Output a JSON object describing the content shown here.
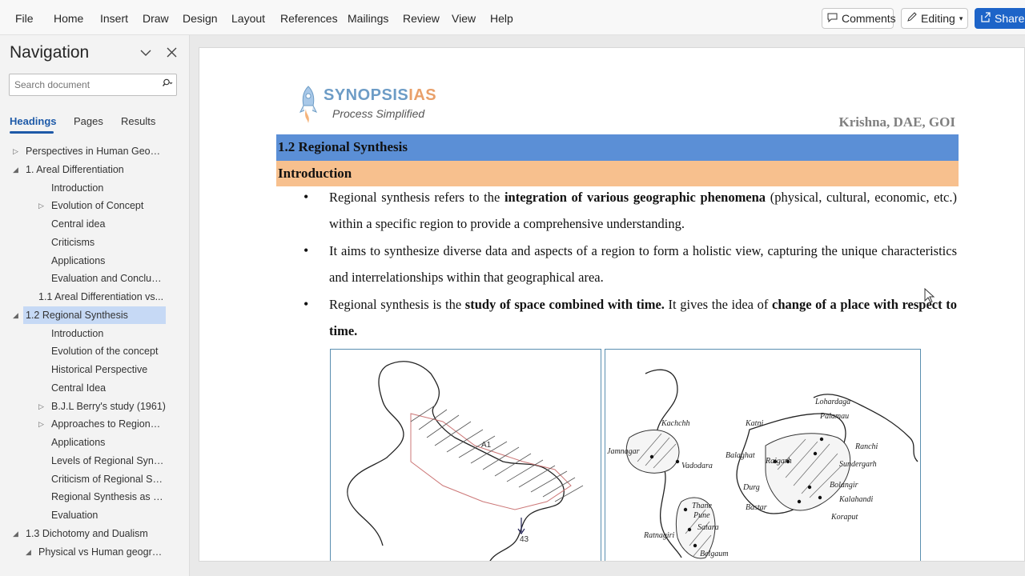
{
  "menu": {
    "items": [
      "File",
      "Home",
      "Insert",
      "Draw",
      "Design",
      "Layout",
      "References",
      "Mailings",
      "Review",
      "View",
      "Help"
    ],
    "comments_label": "Comments",
    "editing_label": "Editing",
    "share_label": "Share"
  },
  "navigation": {
    "title": "Navigation",
    "search_placeholder": "Search document",
    "tabs": [
      "Headings",
      "Pages",
      "Results"
    ],
    "active_tab": "Headings",
    "tree": [
      {
        "label": "Perspectives in Human Geogra...",
        "level": 0,
        "expander": "collapsed"
      },
      {
        "label": "1. Areal Differentiation",
        "level": 0,
        "expander": "expanded"
      },
      {
        "label": "Introduction",
        "level": 2,
        "expander": "none"
      },
      {
        "label": "Evolution of Concept",
        "level": 2,
        "expander": "collapsed"
      },
      {
        "label": "Central idea",
        "level": 2,
        "expander": "none"
      },
      {
        "label": "Criticisms",
        "level": 2,
        "expander": "none"
      },
      {
        "label": "Applications",
        "level": 2,
        "expander": "none"
      },
      {
        "label": "Evaluation and Conclusion",
        "level": 2,
        "expander": "none"
      },
      {
        "label": "1.1 Areal Differentiation vs...",
        "level": 1,
        "expander": "none"
      },
      {
        "label": "1.2 Regional Synthesis",
        "level": 0,
        "expander": "expanded",
        "selected": true
      },
      {
        "label": "Introduction",
        "level": 2,
        "expander": "none"
      },
      {
        "label": "Evolution of the concept",
        "level": 2,
        "expander": "none"
      },
      {
        "label": "Historical Perspective",
        "level": 2,
        "expander": "none"
      },
      {
        "label": "Central Idea",
        "level": 2,
        "expander": "none"
      },
      {
        "label": "B.J.L Berry's study (1961)",
        "level": 2,
        "expander": "collapsed"
      },
      {
        "label": "Approaches to Regional...",
        "level": 2,
        "expander": "collapsed"
      },
      {
        "label": "Applications",
        "level": 2,
        "expander": "none"
      },
      {
        "label": "Levels of Regional Synth...",
        "level": 2,
        "expander": "none"
      },
      {
        "label": "Criticism of Regional Syn...",
        "level": 2,
        "expander": "none"
      },
      {
        "label": "Regional Synthesis as th...",
        "level": 2,
        "expander": "none"
      },
      {
        "label": "Evaluation",
        "level": 2,
        "expander": "none"
      },
      {
        "label": "1.3 Dichotomy and Dualism",
        "level": 0,
        "expander": "expanded"
      },
      {
        "label": "Physical vs Human geogra...",
        "level": 1,
        "expander": "expanded"
      }
    ]
  },
  "document": {
    "logo_main": "SYNOPSIS",
    "logo_accent": "IAS",
    "logo_tagline": "Process Simplified",
    "author": "Krishna, DAE, GOI",
    "section_heading": "1.2 Regional Synthesis",
    "subsection_heading": "Introduction",
    "bullets": [
      {
        "parts": [
          {
            "t": "Regional synthesis refers to the ",
            "b": false
          },
          {
            "t": "integration of various geographic phenomena",
            "b": true
          },
          {
            "t": " (physical, cultural, economic, etc.) within a specific region to provide a comprehensive understanding.",
            "b": false
          }
        ]
      },
      {
        "parts": [
          {
            "t": "It aims to synthesize diverse data and aspects of a region to form a holistic view, capturing the unique characteristics and interrelationships within that geographical area.",
            "b": false
          }
        ]
      },
      {
        "parts": [
          {
            "t": "Regional synthesis is the ",
            "b": false
          },
          {
            "t": "study of space combined with time.",
            "b": true
          },
          {
            "t": " It gives the idea of ",
            "b": false
          },
          {
            "t": "change of a place with respect to time.",
            "b": true
          }
        ]
      }
    ],
    "map1_labels": [
      "A1",
      "43"
    ],
    "map2_labels": [
      "Kachchh",
      "Jamnagar",
      "Vadodara",
      "Katni",
      "Balaghat",
      "Raigarh",
      "Lohardaga",
      "Palamau",
      "Ranchi",
      "Sundergarh",
      "Bolangir",
      "Kalahandi",
      "Koraput",
      "Durg",
      "Bastar",
      "Thane",
      "Pune",
      "Satara",
      "Ratnagiri",
      "Belgaum"
    ]
  }
}
